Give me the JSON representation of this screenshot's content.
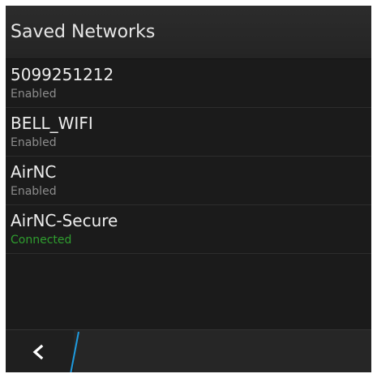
{
  "header": {
    "title": "Saved Networks"
  },
  "networks": [
    {
      "name": "5099251212",
      "status": "Enabled"
    },
    {
      "name": "BELL_WIFI",
      "status": "Enabled"
    },
    {
      "name": "AirNC",
      "status": "Enabled"
    },
    {
      "name": "AirNC-Secure",
      "status": "Connected"
    }
  ],
  "colors": {
    "background": "#1b1b1b",
    "text_primary": "#ececec",
    "text_secondary": "#8c8c8c",
    "connected": "#2f9e2f",
    "accent": "#1e9be0"
  },
  "actionbar": {
    "back_icon": "chevron-left-icon"
  }
}
